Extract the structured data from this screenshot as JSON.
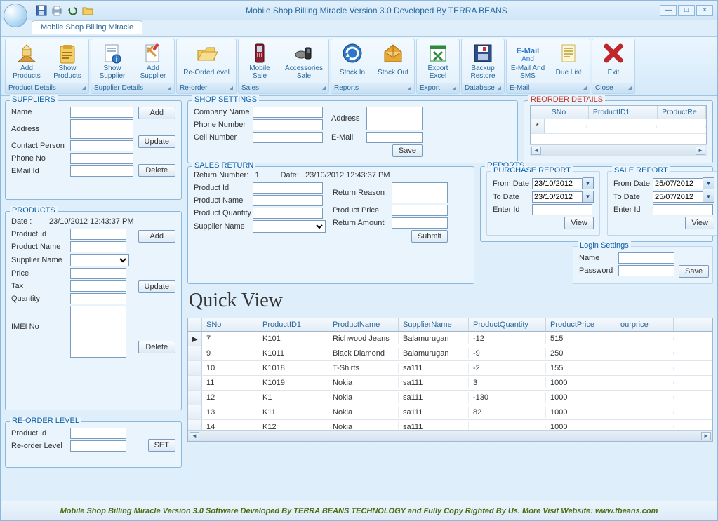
{
  "app": {
    "title": "Mobile Shop Billing Miracle Version 3.0 Developed By TERRA BEANS",
    "tab": "Mobile Shop Billing Miracle",
    "footer": "Mobile Shop Billing Miracle Version 3.0 Software Developed By TERRA BEANS TECHNOLOGY and Fully Copy Righted  By Us. More Visit Website: www.tbeans.com"
  },
  "ribbon": {
    "groups": [
      {
        "footer": "Product Details",
        "items": [
          {
            "label": "Add Products"
          },
          {
            "label": "Show Products"
          }
        ]
      },
      {
        "footer": "Supplier Details",
        "items": [
          {
            "label": "Show Supplier"
          },
          {
            "label": "Add Supplier"
          }
        ]
      },
      {
        "footer": "Re-order",
        "items": [
          {
            "label": "Re-OrderLevel"
          }
        ]
      },
      {
        "footer": "Sales",
        "items": [
          {
            "label": "Mobile Sale"
          },
          {
            "label": "Accessories Sale"
          }
        ]
      },
      {
        "footer": "Reports",
        "items": [
          {
            "label": "Stock In"
          },
          {
            "label": "Stock Out"
          }
        ]
      },
      {
        "footer": "Export",
        "items": [
          {
            "label": "Export Excel"
          }
        ]
      },
      {
        "footer": "Database",
        "items": [
          {
            "label": "Backup Restore"
          }
        ]
      },
      {
        "footer": "E-Mail",
        "items": [
          {
            "label": "E-Mail And SMS"
          },
          {
            "label": "Due List"
          }
        ]
      },
      {
        "footer": "Close",
        "items": [
          {
            "label": "Exit"
          }
        ]
      }
    ]
  },
  "suppliers": {
    "title": "SUPPLIERS",
    "labels": {
      "name": "Name",
      "address": "Address",
      "contact": "Contact Person",
      "phone": "Phone No",
      "email": "EMail Id"
    },
    "buttons": {
      "add": "Add",
      "update": "Update",
      "delete": "Delete"
    }
  },
  "products": {
    "title": "PRODUCTS",
    "dateLabel": "Date    :",
    "dateValue": "23/10/2012 12:43:37 PM",
    "labels": {
      "pid": "Product Id",
      "pname": "Product Name",
      "supplier": "Supplier Name",
      "price": "Price",
      "tax": "Tax",
      "qty": "Quantity",
      "imei": "IMEI No"
    },
    "buttons": {
      "add": "Add",
      "update": "Update",
      "delete": "Delete"
    }
  },
  "reorder": {
    "title": "RE-ORDER LEVEL",
    "labels": {
      "pid": "Product Id",
      "level": "Re-order Level"
    },
    "buttons": {
      "set": "SET"
    }
  },
  "shop": {
    "title": "SHOP SETTINGS",
    "labels": {
      "company": "Company Name",
      "phone": "Phone Number",
      "cell": "Cell Number",
      "address": "Address",
      "email": "E-Mail"
    },
    "buttons": {
      "save": "Save"
    }
  },
  "salesReturn": {
    "title": "SALES RETURN",
    "retNumLabel": "Return Number:",
    "retNum": "1",
    "dateLabel": "Date:",
    "dateValue": "23/10/2012 12:43:37 PM",
    "labels": {
      "pid": "Product Id",
      "pname": "Product Name",
      "qty": "Product Quantity",
      "supplier": "Supplier Name",
      "reason": "Return Reason",
      "price": "Product Price",
      "amount": "Return Amount"
    },
    "buttons": {
      "submit": "Submit"
    }
  },
  "reorderDetails": {
    "title": "REORDER DETAILS",
    "headers": [
      "SNo",
      "ProductID1",
      "ProductRe"
    ]
  },
  "reports": {
    "title": "REPORTS",
    "purchase": {
      "title": "PURCHASE REPORT",
      "fromLabel": "From Date",
      "fromDate": "23/10/2012",
      "toLabel": "To Date",
      "toDate": "23/10/2012",
      "enterLabel": "Enter Id",
      "view": "View"
    },
    "sale": {
      "title": "SALE REPORT",
      "fromLabel": "From Date",
      "fromDate": "25/07/2012",
      "toLabel": "To Date",
      "toDate": "25/07/2012",
      "enterLabel": "Enter Id",
      "view": "View"
    }
  },
  "login": {
    "title": "Login Settings",
    "nameLabel": "Name",
    "pwdLabel": "Password",
    "save": "Save"
  },
  "quickview": {
    "title": "Quick View"
  },
  "grid": {
    "headers": [
      "SNo",
      "ProductID1",
      "ProductName",
      "SupplierName",
      "ProductQuantity",
      "ProductPrice",
      "ourprice"
    ],
    "rows": [
      [
        "7",
        "K101",
        "Richwood Jeans",
        "Balamurugan",
        "-12",
        "515",
        ""
      ],
      [
        "9",
        "K1011",
        "Black Diamond",
        "Balamurugan",
        "-9",
        "250",
        ""
      ],
      [
        "10",
        "K1018",
        "T-Shirts",
        "sa111",
        "-2",
        "155",
        ""
      ],
      [
        "11",
        "K1019",
        "Nokia",
        "sa111",
        "3",
        "1000",
        ""
      ],
      [
        "12",
        "K1",
        "Nokia",
        "sa111",
        "-130",
        "1000",
        ""
      ],
      [
        "13",
        "K11",
        "Nokia",
        "sa111",
        "82",
        "1000",
        ""
      ],
      [
        "14",
        "K12",
        "Nokia",
        "sa111",
        "",
        "1000",
        ""
      ]
    ]
  }
}
